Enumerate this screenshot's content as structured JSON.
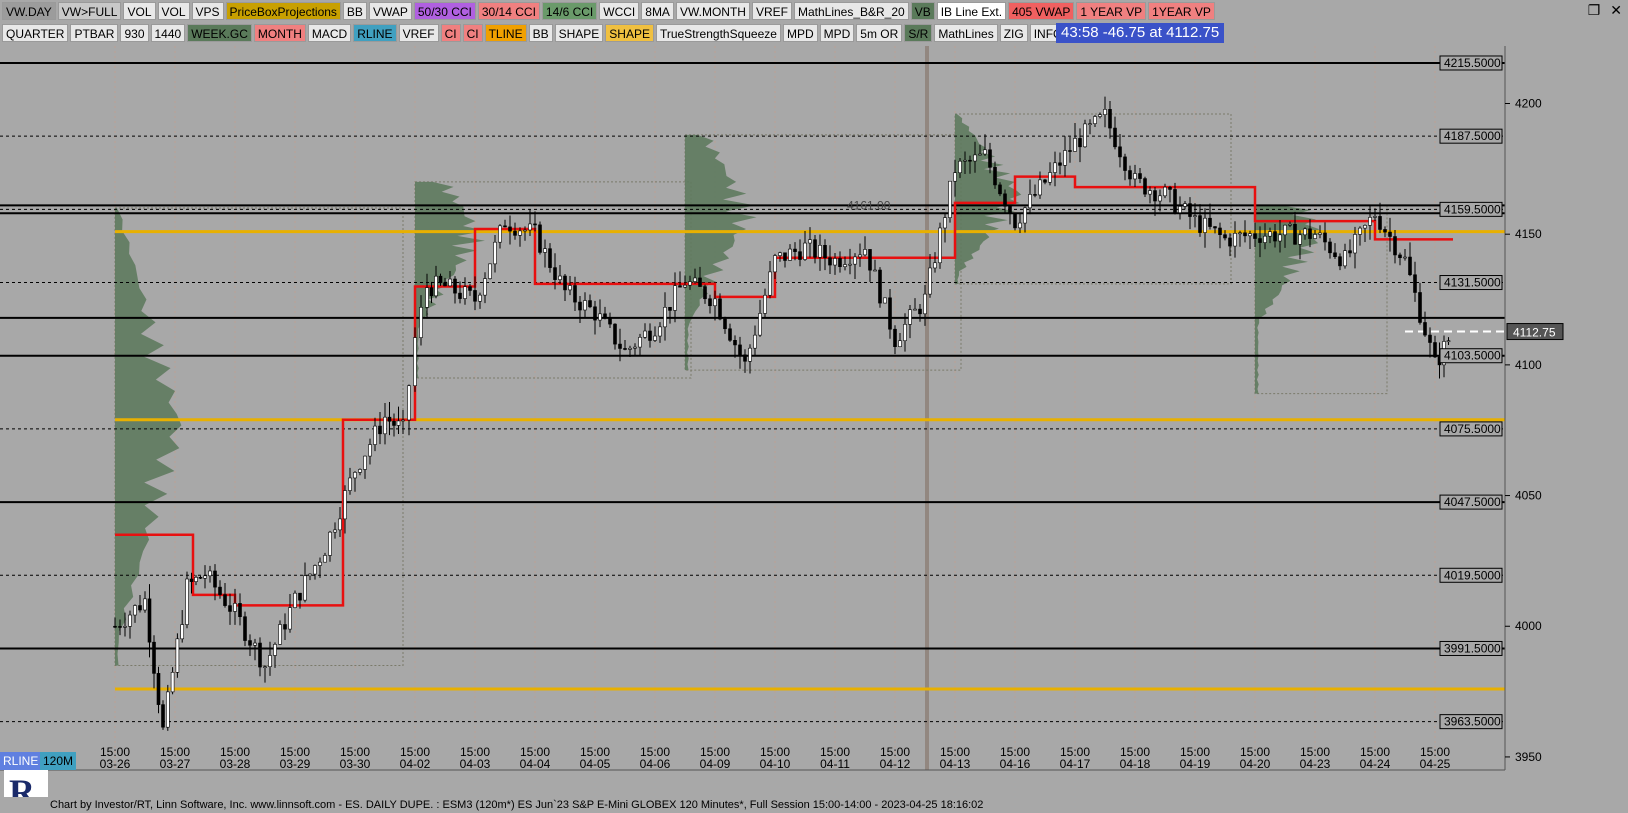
{
  "toolbar1": [
    {
      "label": "VW.DAY",
      "bg": "#9c9c9c"
    },
    {
      "label": "VW>FULL",
      "bg": "#c8c8c8"
    },
    {
      "label": "VOL",
      "bg": "#e8e8e8"
    },
    {
      "label": "VOL",
      "bg": "#e8e8e8"
    },
    {
      "label": "VPS",
      "bg": "#e8e8e8"
    },
    {
      "label": "PriceBoxProjections",
      "bg": "#c8a000"
    },
    {
      "label": "BB",
      "bg": "#e8e8e8"
    },
    {
      "label": "VWAP",
      "bg": "#e8e8e8"
    },
    {
      "label": "50/30 CCI",
      "bg": "#b060e0"
    },
    {
      "label": "30/14 CCI",
      "bg": "#f08080"
    },
    {
      "label": "14/6 CCI",
      "bg": "#6a9a6a"
    },
    {
      "label": "WCCI",
      "bg": "#e8e8e8"
    },
    {
      "label": "8MA",
      "bg": "#e8e8e8"
    },
    {
      "label": "VW.MONTH",
      "bg": "#e8e8e8"
    },
    {
      "label": "VREF",
      "bg": "#e8e8e8"
    },
    {
      "label": "MathLines_B&R_20",
      "bg": "#e8e8e8"
    },
    {
      "label": "VB",
      "bg": "#5a7a5a"
    },
    {
      "label": "IB Line Ext.",
      "bg": "#ffffff"
    },
    {
      "label": "405 VWAP",
      "bg": "#f06060"
    },
    {
      "label": "1 YEAR VP",
      "bg": "#f08080"
    },
    {
      "label": "1YEAR VP",
      "bg": "#f08080"
    }
  ],
  "toolbar2": [
    {
      "label": "QUARTER",
      "bg": "#e8e8e8"
    },
    {
      "label": "PTBAR",
      "bg": "#e8e8e8"
    },
    {
      "label": "930",
      "bg": "#e8e8e8"
    },
    {
      "label": "1440",
      "bg": "#e8e8e8"
    },
    {
      "label": "WEEK.GC",
      "bg": "#5a7a5a"
    },
    {
      "label": "MONTH",
      "bg": "#f08080"
    },
    {
      "label": "MACD",
      "bg": "#e8e8e8"
    },
    {
      "label": "RLINE",
      "bg": "#40a0c0"
    },
    {
      "label": "VREF",
      "bg": "#e8e8e8"
    },
    {
      "label": "CI",
      "bg": "#f08080"
    },
    {
      "label": "CI",
      "bg": "#f08080"
    },
    {
      "label": "TLINE",
      "bg": "#f0a000"
    },
    {
      "label": "BB",
      "bg": "#e8e8e8"
    },
    {
      "label": "SHAPE",
      "bg": "#e8e8e8"
    },
    {
      "label": "SHAPE",
      "bg": "#f0c040"
    },
    {
      "label": "TrueStrengthSqueeze",
      "bg": "#e8e8e8"
    },
    {
      "label": "MPD",
      "bg": "#e8e8e8"
    },
    {
      "label": "MPD",
      "bg": "#e8e8e8"
    },
    {
      "label": "5m OR",
      "bg": "#e8e8e8"
    },
    {
      "label": "S/R",
      "bg": "#5a7a5a"
    },
    {
      "label": "MathLines",
      "bg": "#e8e8e8"
    },
    {
      "label": "ZIG",
      "bg": "#e8e8e8"
    },
    {
      "label": "INFO",
      "bg": "#e8e8e8"
    }
  ],
  "header": {
    "countdown": "43:58  -46.75 at 4112.75"
  },
  "window_icons": [
    "restore-icon",
    "close-icon"
  ],
  "bottom_tags": {
    "rline": "RLINE",
    "interval": "120M"
  },
  "footer": {
    "text": "Chart by Investor/RT, Linn Software, Inc. www.linnsoft.com - ES. DAILY DUPE.   : ESM3 (120m*) ES Jun`23 S&P E-Mini GLOBEX 120 Minutes*, Full Session 15:00-14:00 - 2023-04-25 18:16:02"
  },
  "colors": {
    "background": "#a8a8a8",
    "profile": "#5e7a5e",
    "poc": "#e8b000",
    "vwap": "#e81010",
    "level": "#000000",
    "current": "#ffffff"
  },
  "chart_data": {
    "type": "candlestick",
    "symbol": "ESM3",
    "interval": "120M",
    "ylim": [
      3945,
      4222
    ],
    "y_ticks": [
      4200,
      4150,
      4100,
      4050,
      4000,
      3950
    ],
    "current_price": "4112.75",
    "annotations": [
      {
        "text": "4161.00",
        "price": 4161
      }
    ],
    "price_levels": [
      {
        "label": "4215.5000",
        "value": 4215.5
      },
      {
        "label": "4187.5000",
        "value": 4187.5
      },
      {
        "label": "4159.5000",
        "value": 4159.5
      },
      {
        "label": "4131.5000",
        "value": 4131.5
      },
      {
        "label": "4103.5000",
        "value": 4103.5
      },
      {
        "label": "4075.5000",
        "value": 4075.5
      },
      {
        "label": "4047.5000",
        "value": 4047.5
      },
      {
        "label": "4019.5000",
        "value": 4019.5
      },
      {
        "label": "3991.5000",
        "value": 3991.5
      },
      {
        "label": "3963.5000",
        "value": 3963.5
      }
    ],
    "solid_lines": [
      4215.5,
      4161,
      4158,
      4118,
      4103.5,
      4047.5,
      3991.5
    ],
    "poc_lines": [
      4079,
      3976,
      4151
    ],
    "dates": [
      {
        "time": "15:00",
        "date": "03-26"
      },
      {
        "time": "15:00",
        "date": "03-27"
      },
      {
        "time": "15:00",
        "date": "03-28"
      },
      {
        "time": "15:00",
        "date": "03-29"
      },
      {
        "time": "15:00",
        "date": "03-30"
      },
      {
        "time": "15:00",
        "date": "04-02"
      },
      {
        "time": "15:00",
        "date": "04-03"
      },
      {
        "time": "15:00",
        "date": "04-04"
      },
      {
        "time": "15:00",
        "date": "04-05"
      },
      {
        "time": "15:00",
        "date": "04-06"
      },
      {
        "time": "15:00",
        "date": "04-09"
      },
      {
        "time": "15:00",
        "date": "04-10"
      },
      {
        "time": "15:00",
        "date": "04-11"
      },
      {
        "time": "15:00",
        "date": "04-12"
      },
      {
        "time": "15:00",
        "date": "04-13"
      },
      {
        "time": "15:00",
        "date": "04-16"
      },
      {
        "time": "15:00",
        "date": "04-17"
      },
      {
        "time": "15:00",
        "date": "04-18"
      },
      {
        "time": "15:00",
        "date": "04-19"
      },
      {
        "time": "15:00",
        "date": "04-20"
      },
      {
        "time": "15:00",
        "date": "04-23"
      },
      {
        "time": "15:00",
        "date": "04-24"
      },
      {
        "time": "15:00",
        "date": "04-25"
      }
    ],
    "close_path": [
      [
        0,
        4000
      ],
      [
        0.5,
        4010
      ],
      [
        0.8,
        3960
      ],
      [
        1.2,
        4015
      ],
      [
        1.5,
        4020
      ],
      [
        2,
        4005
      ],
      [
        2.5,
        3985
      ],
      [
        3,
        4010
      ],
      [
        3.5,
        4030
      ],
      [
        4,
        4060
      ],
      [
        4.5,
        4080
      ],
      [
        4.8,
        4075
      ],
      [
        5,
        4110
      ],
      [
        5.2,
        4130
      ],
      [
        5.5,
        4130
      ],
      [
        6,
        4125
      ],
      [
        6.5,
        4155
      ],
      [
        7,
        4150
      ],
      [
        7.5,
        4128
      ],
      [
        8,
        4120
      ],
      [
        8.5,
        4105
      ],
      [
        9,
        4115
      ],
      [
        9.5,
        4132
      ],
      [
        10,
        4125
      ],
      [
        10.5,
        4100
      ],
      [
        11,
        4140
      ],
      [
        11.5,
        4145
      ],
      [
        12,
        4140
      ],
      [
        12.5,
        4145
      ],
      [
        13,
        4110
      ],
      [
        13.5,
        4125
      ],
      [
        14,
        4175
      ],
      [
        14.5,
        4180
      ],
      [
        15,
        4155
      ],
      [
        15.5,
        4170
      ],
      [
        16,
        4185
      ],
      [
        16.5,
        4195
      ],
      [
        17,
        4170
      ],
      [
        17.5,
        4165
      ],
      [
        18,
        4155
      ],
      [
        18.5,
        4148
      ],
      [
        19,
        4150
      ],
      [
        20,
        4150
      ],
      [
        20.5,
        4140
      ],
      [
        21,
        4158
      ],
      [
        21.5,
        4140
      ],
      [
        22,
        4100
      ],
      [
        22.3,
        4112.75
      ]
    ],
    "vwap_steps": [
      [
        0,
        4035
      ],
      [
        1.3,
        4035
      ],
      [
        1.3,
        4012
      ],
      [
        2,
        4012
      ],
      [
        2,
        4008
      ],
      [
        3.8,
        4008
      ],
      [
        3.8,
        4079
      ],
      [
        5,
        4079
      ],
      [
        5,
        4130
      ],
      [
        6,
        4130
      ],
      [
        6,
        4152
      ],
      [
        7,
        4152
      ],
      [
        7,
        4131
      ],
      [
        10,
        4131
      ],
      [
        10,
        4126
      ],
      [
        11,
        4126
      ],
      [
        11,
        4141
      ],
      [
        14,
        4141
      ],
      [
        14,
        4162
      ],
      [
        15,
        4162
      ],
      [
        15,
        4172
      ],
      [
        16,
        4172
      ],
      [
        16,
        4168
      ],
      [
        19,
        4168
      ],
      [
        19,
        4155
      ],
      [
        21,
        4155
      ],
      [
        21,
        4148
      ],
      [
        22.3,
        4148
      ]
    ]
  }
}
